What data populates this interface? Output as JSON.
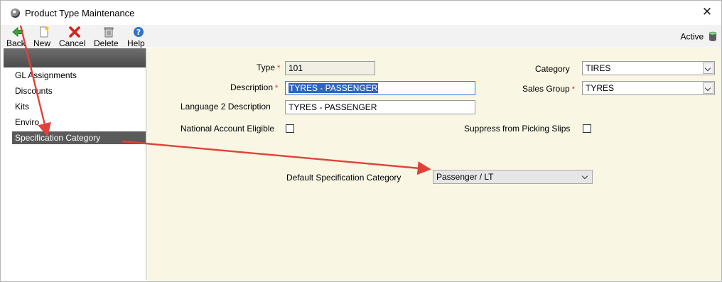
{
  "window": {
    "title": "Product Type Maintenance",
    "close_glyph": "✕"
  },
  "toolbar": {
    "buttons": [
      {
        "label": "Back",
        "icon": "back-arrow-icon"
      },
      {
        "label": "New",
        "icon": "new-document-icon"
      },
      {
        "label": "Cancel",
        "icon": "cancel-x-icon"
      },
      {
        "label": "Delete",
        "icon": "trash-icon"
      },
      {
        "label": "Help",
        "icon": "help-icon"
      }
    ],
    "status_label": "Active",
    "status_icon": "database-icon"
  },
  "sidebar": {
    "items": [
      {
        "label": "GL Assignments",
        "selected": false
      },
      {
        "label": "Discounts",
        "selected": false
      },
      {
        "label": "Kits",
        "selected": false
      },
      {
        "label": "Enviro",
        "selected": false
      },
      {
        "label": "Specification Category",
        "selected": true
      }
    ]
  },
  "form": {
    "type": {
      "label": "Type",
      "value": "101",
      "required": true
    },
    "description": {
      "label": "Description",
      "value": "TYRES - PASSENGER",
      "required": true
    },
    "language2_description": {
      "label": "Language 2 Description",
      "value": "TYRES - PASSENGER"
    },
    "national_account_eligible": {
      "label": "National Account Eligible",
      "checked": false
    },
    "category": {
      "label": "Category",
      "value": "TIRES"
    },
    "sales_group": {
      "label": "Sales Group",
      "value": "TYRES",
      "required": true
    },
    "suppress_picking_slips": {
      "label": "Suppress from Picking Slips",
      "checked": false
    },
    "default_spec_category": {
      "label": "Default Specification Category",
      "value": "Passenger / LT"
    },
    "required_marker": "*"
  },
  "colors": {
    "content_bg": "#f9f6e3",
    "selection_bg": "#2f66c1",
    "required": "#e2231a",
    "annotation_arrow": "#e0413a"
  }
}
